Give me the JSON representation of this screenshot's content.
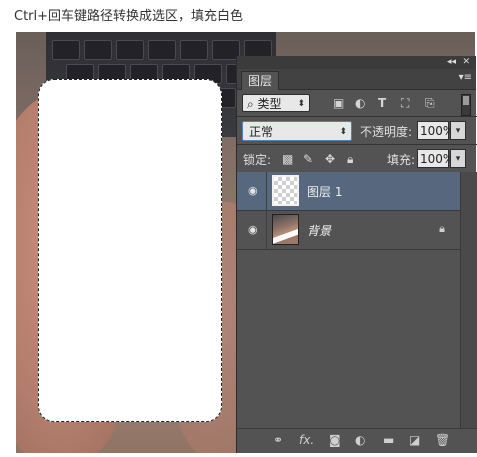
{
  "caption": "Ctrl+回车键路径转换成选区，填充白色",
  "panel": {
    "window_controls": [
      "◂◂",
      "✕"
    ],
    "tab_label": "图层",
    "tab_menu_icon": "menu-icon",
    "filter_kind": "类型",
    "filter_icons": [
      "image-filter-icon",
      "adjustment-filter-icon",
      "type-filter-icon",
      "shape-filter-icon",
      "smart-object-filter-icon"
    ],
    "blend_mode": "正常",
    "opacity_label": "不透明度:",
    "opacity_value": "100%",
    "lock_label": "锁定:",
    "lock_icons": [
      "lock-transparent-icon",
      "lock-image-icon",
      "lock-position-icon",
      "lock-all-icon"
    ],
    "fill_label": "填充:",
    "fill_value": "100%",
    "layers": [
      {
        "name": "图层 1",
        "selected": true,
        "visible": true,
        "locked": false
      },
      {
        "name": "背景",
        "selected": false,
        "visible": true,
        "locked": true
      }
    ],
    "bottom_icons": [
      "link-layers-icon",
      "fx-icon",
      "add-mask-icon",
      "new-adjustment-icon",
      "new-group-icon",
      "new-layer-icon",
      "delete-layer-icon"
    ],
    "fx_label": "fx."
  }
}
